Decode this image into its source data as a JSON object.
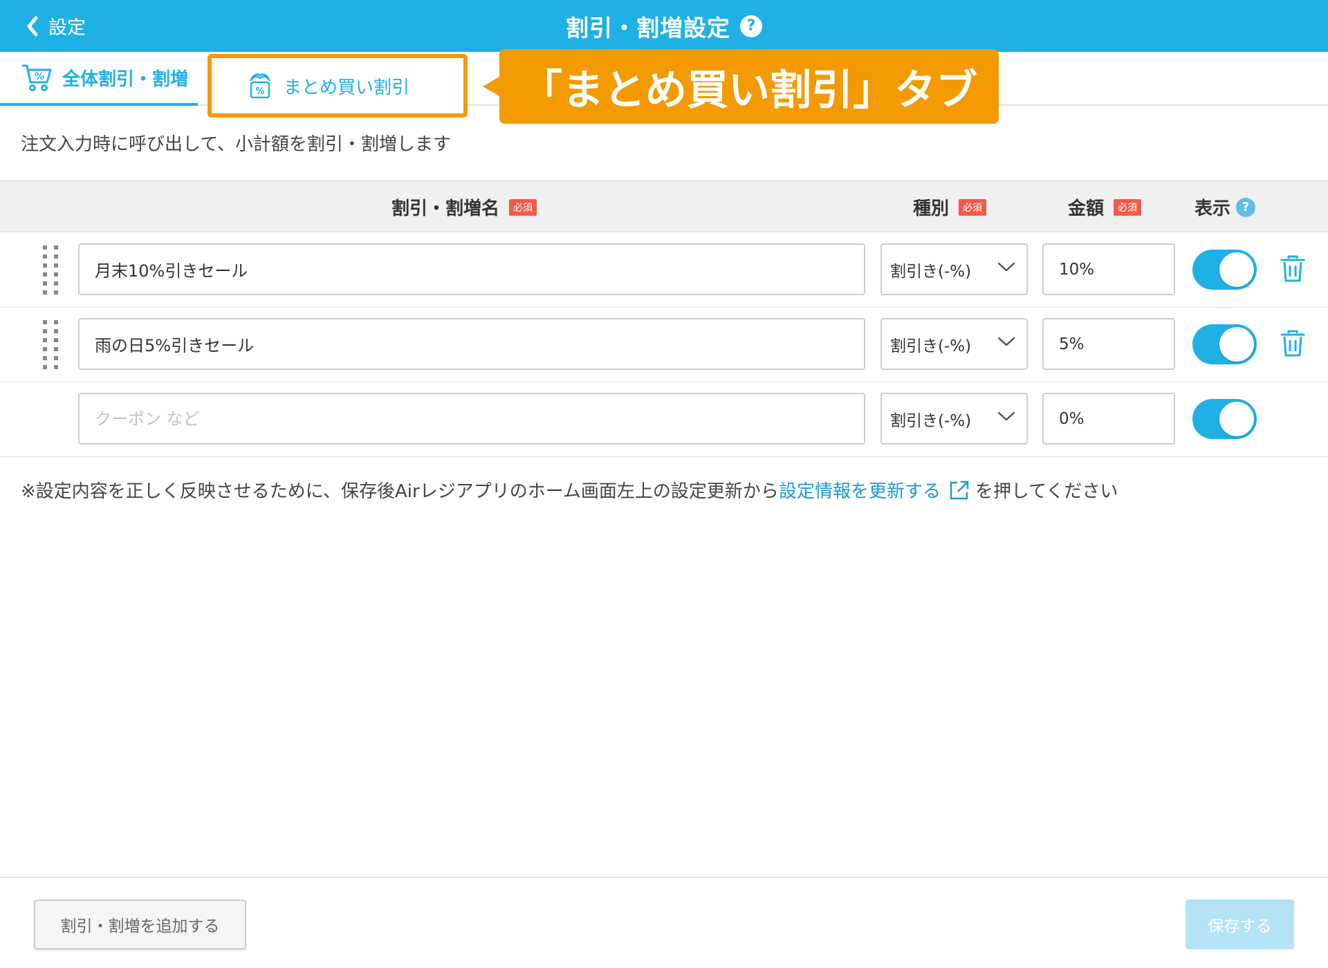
{
  "header": {
    "back_label": "設定",
    "title": "割引・割増設定",
    "help_symbol": "?",
    "background_color": "#1fb0e6"
  },
  "tabs": [
    {
      "label": "全体割引・割増",
      "icon": "cart-percent-icon",
      "active": true
    },
    {
      "label": "まとめ買い割引",
      "icon": "bundle-percent-icon",
      "active": false
    }
  ],
  "callout": {
    "text": "「まとめ買い割引」タブ",
    "color": "#f39a00"
  },
  "description": "注文入力時に呼び出して、小計額を割引・割増します",
  "table": {
    "columns": {
      "name": "割引・割増名",
      "type": "種別",
      "amount": "金額",
      "display": "表示",
      "required_badge": "必須",
      "help_symbol": "?"
    },
    "rows": [
      {
        "name": "月末10%引きセール",
        "name_placeholder": "",
        "type": "割引き(-%)",
        "amount": "10%",
        "display_on": true,
        "deletable": true
      },
      {
        "name": "雨の日5%引きセール",
        "name_placeholder": "",
        "type": "割引き(-%)",
        "amount": "5%",
        "display_on": true,
        "deletable": true
      },
      {
        "name": "",
        "name_placeholder": "クーポン など",
        "type": "割引き(-%)",
        "amount": "0%",
        "display_on": true,
        "deletable": false
      }
    ]
  },
  "note": {
    "prefix": "※設定内容を正しく反映させるために、保存後Airレジアプリのホーム画面左上の設定更新から",
    "link": "設定情報を更新する",
    "suffix": "を押してください"
  },
  "footer": {
    "add_button": "割引・割増を追加する",
    "save_button": "保存する"
  }
}
